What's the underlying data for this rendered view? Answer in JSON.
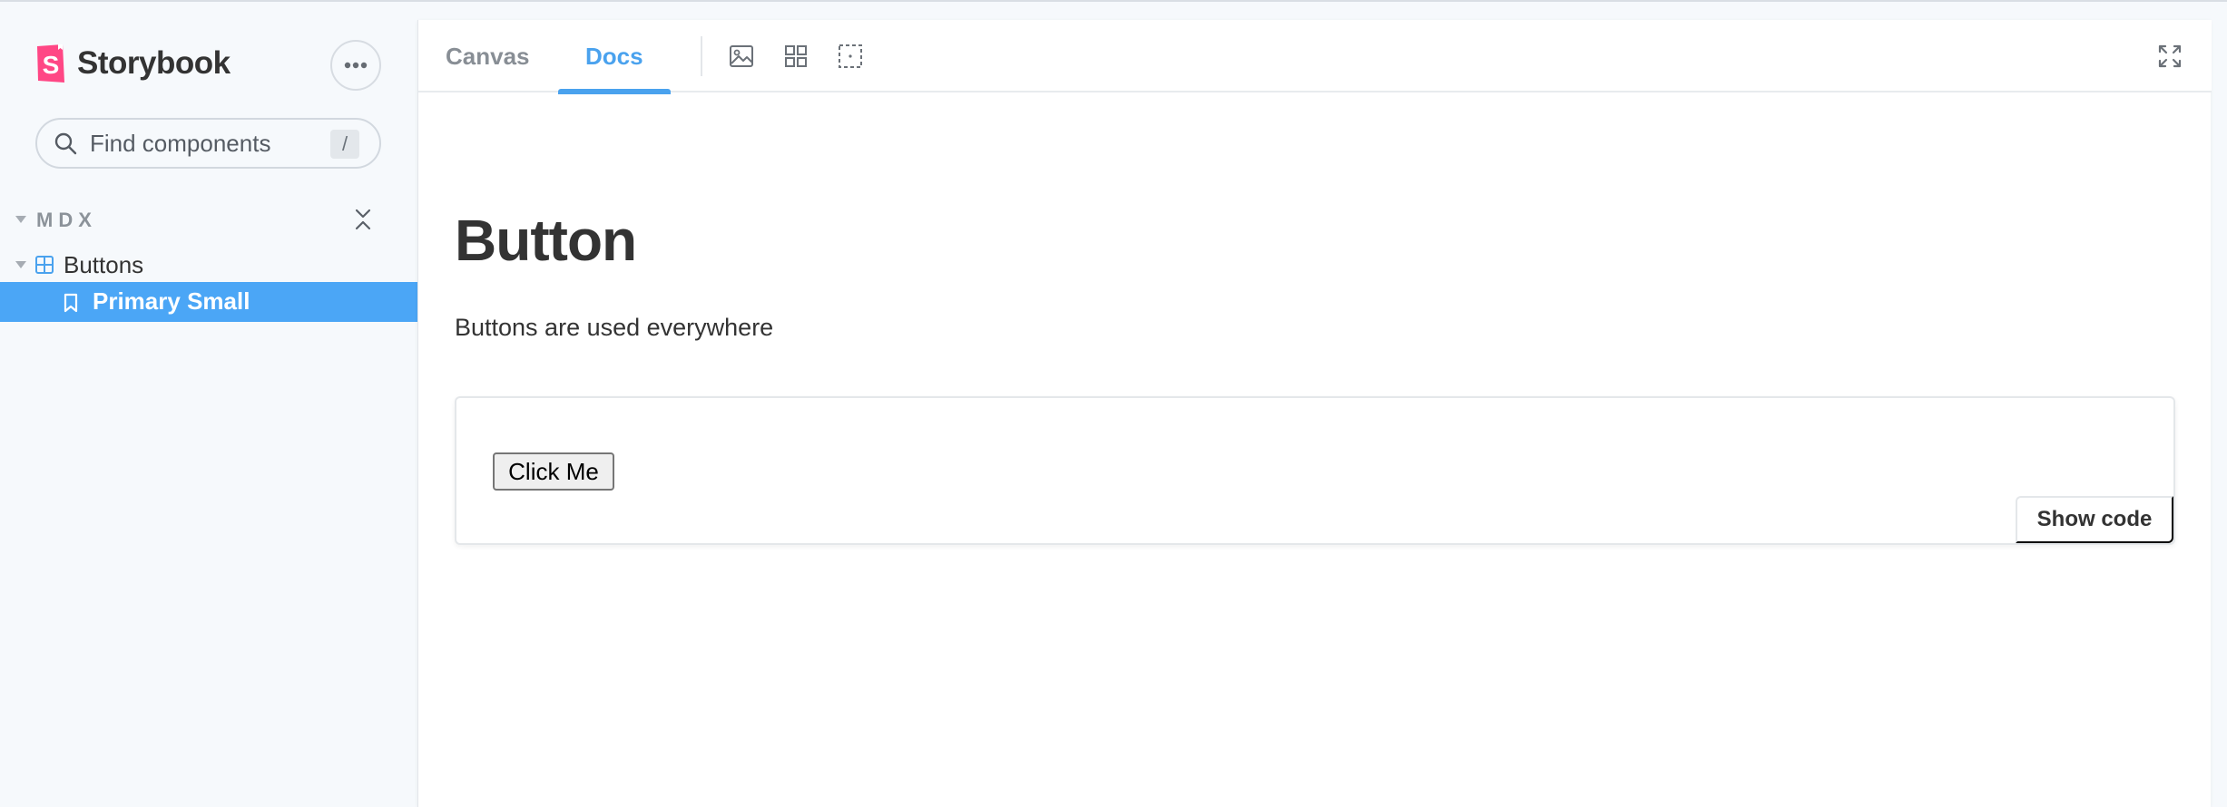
{
  "app": {
    "name": "Storybook",
    "logo_icon": "storybook-logo-icon",
    "menu_icon": "ellipsis-icon"
  },
  "search": {
    "placeholder": "Find components",
    "shortcut": "/",
    "icon": "search-icon"
  },
  "sidebar": {
    "group": {
      "label": "MDX",
      "collapse_icon": "collapse-all-icon"
    },
    "items": [
      {
        "label": "Buttons",
        "type": "component",
        "icon": "component-icon"
      },
      {
        "label": "Primary Small",
        "type": "story",
        "icon": "bookmark-icon",
        "selected": true
      }
    ]
  },
  "toolbar": {
    "tabs": [
      {
        "label": "Canvas",
        "active": false
      },
      {
        "label": "Docs",
        "active": true
      }
    ],
    "tools": [
      "image-icon",
      "grid-icon",
      "outline-icon"
    ],
    "fullscreen_icon": "fullscreen-icon"
  },
  "doc": {
    "title": "Button",
    "description": "Buttons are used everywhere",
    "preview": {
      "button_label": "Click Me",
      "show_code_label": "Show code"
    }
  },
  "colors": {
    "accent": "#4aa2ee",
    "selected_bg": "#4ba6f6",
    "logo": "#ff4785",
    "sidebar_bg": "#f6f9fc"
  }
}
